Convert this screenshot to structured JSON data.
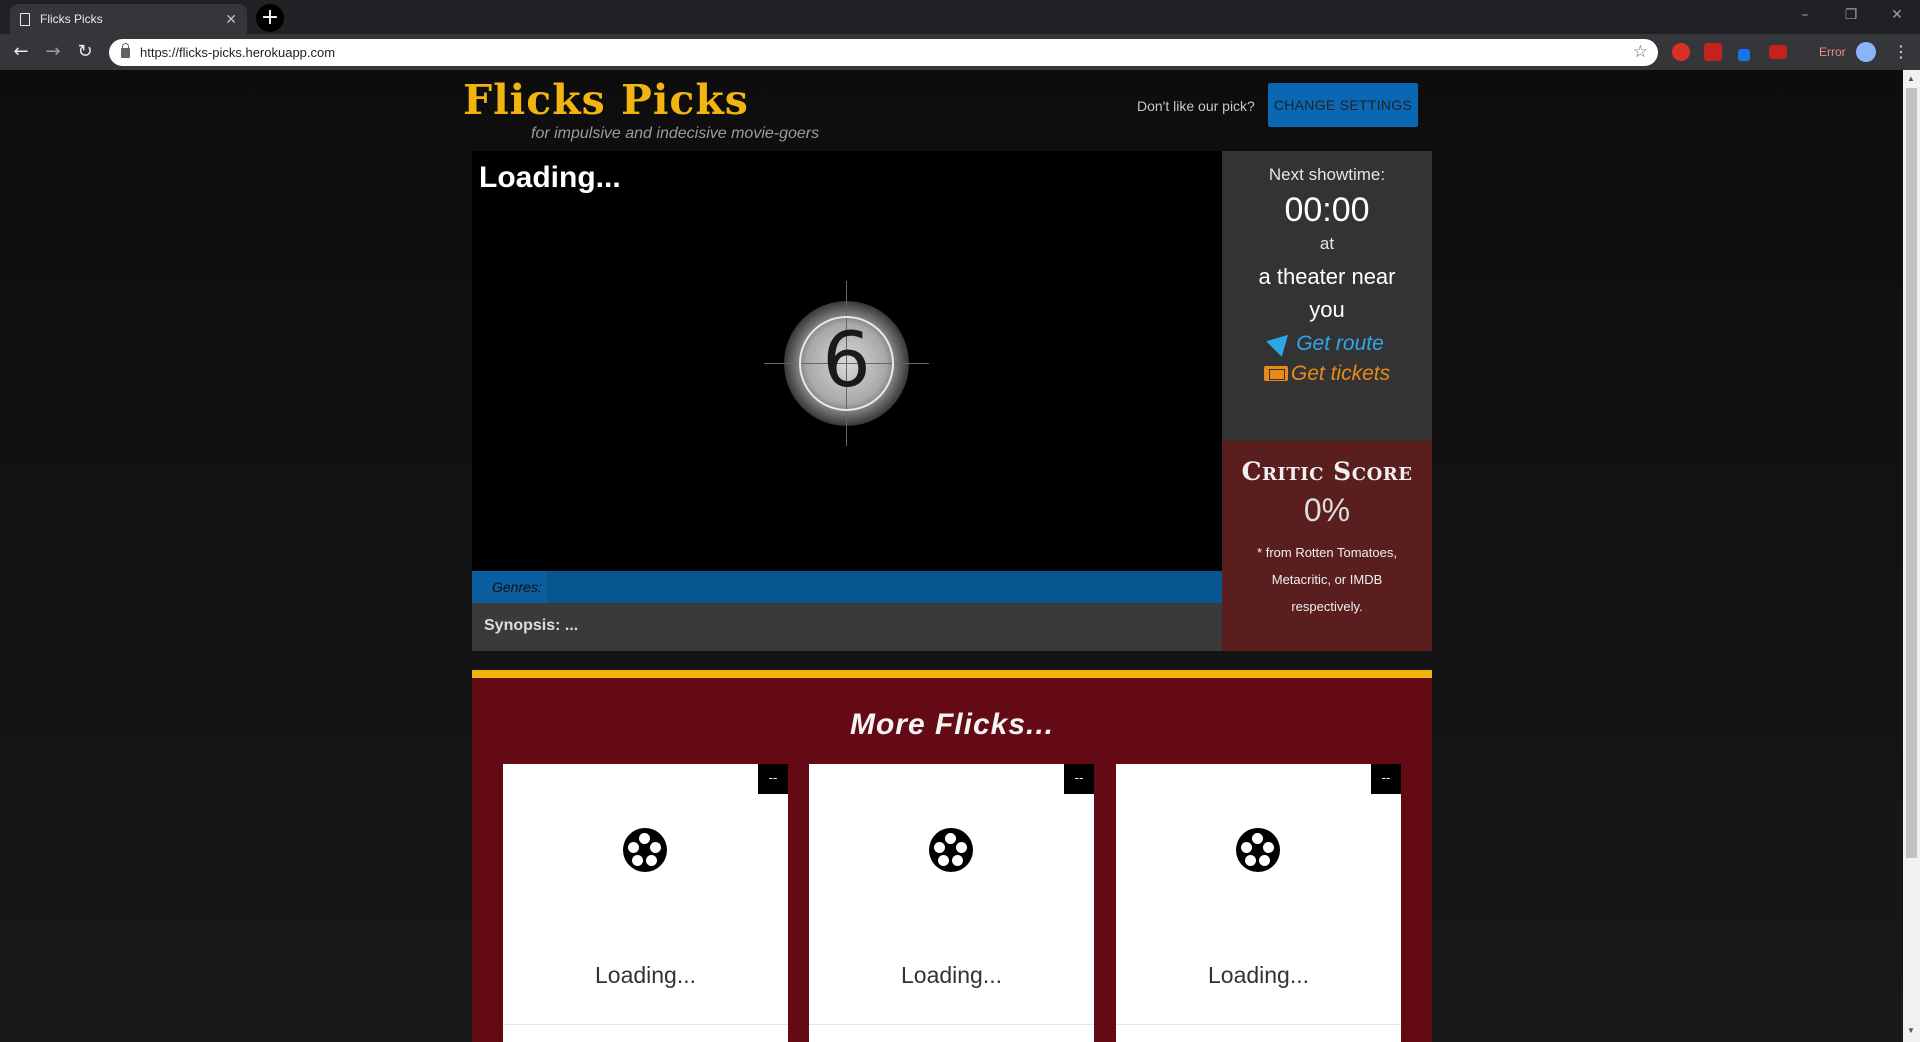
{
  "browser": {
    "tab_title": "Flicks Picks",
    "url": "https://flicks-picks.herokuapp.com",
    "error_label": "Error"
  },
  "header": {
    "brand": "Flicks Picks",
    "tagline": "for impulsive and indecisive movie-goers",
    "dislike_text": "Don't like our pick?",
    "settings_button": "CHANGE SETTINGS"
  },
  "feature": {
    "title": "Loading...",
    "countdown_number": "6",
    "genres_label": "Genres:",
    "synopsis": "Synopsis: ..."
  },
  "showtime": {
    "label": "Next showtime:",
    "time": "00:00",
    "at": "at",
    "theater": "a theater near you",
    "route_link": "Get route",
    "tickets_link": "Get tickets"
  },
  "critic": {
    "heading": "Critic Score",
    "score": "0%",
    "note": "* from Rotten Tomatoes, Metacritic, or IMDB respectively."
  },
  "more_flicks": {
    "heading": "More Flicks...",
    "cards": [
      {
        "badge": "--",
        "status": "Loading..."
      },
      {
        "badge": "--",
        "status": "Loading..."
      },
      {
        "badge": "--",
        "status": "Loading..."
      }
    ]
  },
  "colors": {
    "brand_gold": "#f2b50f",
    "button_blue": "#0a67b3",
    "route_blue": "#2ea7e8",
    "ticket_orange": "#e8891a",
    "critic_bg": "#5a1e1e",
    "more_bg": "#640a14"
  }
}
